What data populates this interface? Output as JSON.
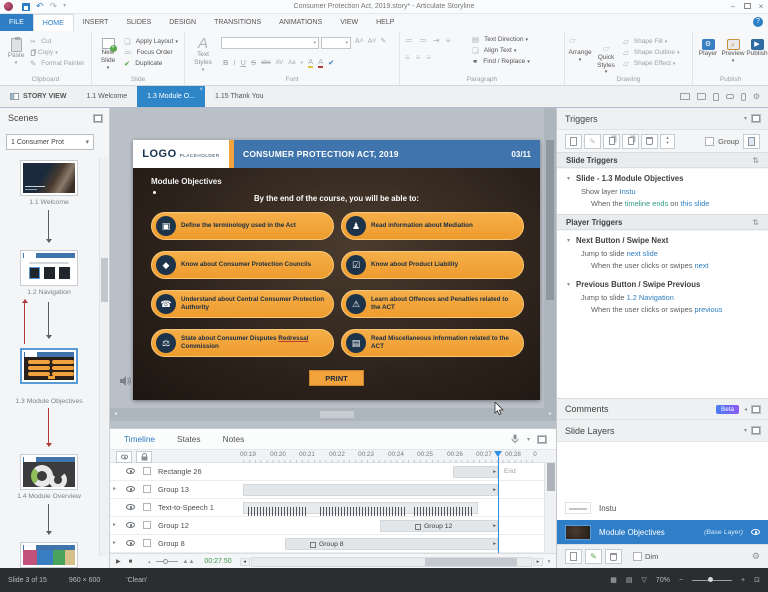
{
  "window": {
    "title": "Consumer Protection Act, 2019.story* - Articulate Storyline"
  },
  "icons": {
    "undo": "↶",
    "redo": "↷",
    "caret": "▾",
    "close": "×",
    "minimize": "–",
    "cut": "✂",
    "gear": "⚙",
    "help": "?",
    "sort": "⇅",
    "left": "◂",
    "right": "▸",
    "up": "▴",
    "down": "▾",
    "play": "▶",
    "stop": "■",
    "grid": "▦",
    "book": "▤",
    "funnel": "▽",
    "minus": "−",
    "plus": "+",
    "fit": "⊡",
    "pencil": "✎",
    "bullets": "≔",
    "numbering": "≕",
    "indent": "⇥",
    "align": "≡",
    "shapes": "▱",
    "arrange_ic": "❏",
    "check": "✔"
  },
  "ribbon_tabs": [
    "FILE",
    "HOME",
    "INSERT",
    "SLIDES",
    "DESIGN",
    "TRANSITIONS",
    "ANIMATIONS",
    "VIEW",
    "HELP"
  ],
  "ribbon": {
    "clipboard": {
      "paste": "Paste",
      "cut": "Cut",
      "copy": "Copy",
      "format_painter": "Format Painter",
      "label": "Clipboard"
    },
    "slide": {
      "new_slide": "New Slide",
      "apply_layout": "Apply Layout",
      "focus_order": "Focus Order",
      "duplicate": "Duplicate",
      "label": "Slide"
    },
    "font": {
      "text_styles": "Text Styles",
      "bold": "B",
      "italic": "I",
      "underline": "U",
      "strike": "S",
      "abc": "abc",
      "av": "AV",
      "aa": "Aa",
      "color": "A",
      "label": "Font"
    },
    "paragraph": {
      "text_direction": "Text Direction",
      "align_text": "Align Text",
      "find_replace": "Find / Replace",
      "label": "Paragraph"
    },
    "drawing": {
      "arrange": "Arrange",
      "quick_styles": "Quick Styles",
      "shape_fill": "Shape Fill",
      "shape_outline": "Shape Outline",
      "shape_effect": "Shape Effect",
      "label": "Drawing"
    },
    "publish": {
      "player": "Player",
      "preview": "Preview",
      "publish": "Publish",
      "label": "Publish"
    }
  },
  "view_tabs": {
    "story_view": "STORY VIEW",
    "items": [
      "1.1 Welcome",
      "1.3 Module O...",
      "1.15 Thank You"
    ]
  },
  "scenes": {
    "title": "Scenes",
    "dropdown": "1 Consumer Prot",
    "items": [
      {
        "label": "1.1 Welcome"
      },
      {
        "label": "1.2 Navigation"
      },
      {
        "label": "1.3 Module Objectives"
      },
      {
        "label": "1.4 Module Overview"
      }
    ]
  },
  "slide": {
    "logo": "LOGO",
    "logo_sub": "PLACEHOLDER",
    "title": "CONSUMER PROTECTION ACT, 2019",
    "page": "03/11",
    "heading": "Module Objectives",
    "intro": "By the end of the course, you will be able to:",
    "objectives": [
      "Define the terminology used in the Act",
      "Read information about Mediation",
      "Know about Consumer Protection Councils",
      "Know about Product Liability",
      "Understand about Central Consumer Protection Authority",
      "Learn about Offences and Penalties related to the ACT",
      "State about Consumer Disputes ",
      "Read Miscellaneous information related to the ACT"
    ],
    "objective7_redressal": "Redressal",
    "objective7_tail": " Commission",
    "objective_icons": [
      "▣",
      "♟",
      "◆",
      "☑",
      "☎",
      "⚠",
      "⚖",
      "▤"
    ],
    "print": "PRINT"
  },
  "triggers": {
    "title": "Triggers",
    "group_label": "Group",
    "slide_triggers_label": "Slide Triggers",
    "slide_group": "Slide - 1.3 Module Objectives",
    "show_layer_pre": "Show layer ",
    "show_layer_link": "Instu",
    "when1_pre": "When the ",
    "when1_kw": "timeline ends",
    "when1_mid": " on ",
    "when1_link": "this slide",
    "player_triggers_label": "Player Triggers",
    "next_group": "Next Button / Swipe Next",
    "next_action_pre": "Jump to slide ",
    "next_action_link": "next slide",
    "next_when_pre": "When the user clicks or swipes ",
    "next_when_link": "next",
    "prev_group": "Previous Button / Swipe Previous",
    "prev_action_pre": "Jump to slide ",
    "prev_action_link": "1.2 Navigation",
    "prev_when_pre": "When the user clicks or swipes ",
    "prev_when_link": "previous"
  },
  "comments": {
    "title": "Comments",
    "badge": "Beta"
  },
  "slide_layers": {
    "title": "Slide Layers",
    "items": [
      {
        "name": "Instu",
        "tag": ""
      },
      {
        "name": "Module Objectives",
        "tag": "(Base Layer)"
      }
    ],
    "dim_label": "Dim"
  },
  "timeline": {
    "tabs": [
      "Timeline",
      "States",
      "Notes"
    ],
    "ruler": [
      "00:19",
      "00:20",
      "00:21",
      "00:22",
      "00:23",
      "00:24",
      "00:25",
      "00:26",
      "00:27",
      "00:28",
      "0"
    ],
    "rows": [
      {
        "name": "Rectangle 26"
      },
      {
        "name": "Group 13"
      },
      {
        "name": "Text-to-Speech 1"
      },
      {
        "name": "Group 12",
        "bar_label": "Group 12"
      },
      {
        "name": "Group 8",
        "bar_label": "Group 8"
      }
    ],
    "end_label": "End",
    "time": "00:27.50"
  },
  "status": {
    "slide_info": "Slide 3 of 15",
    "dimensions": "960 × 600",
    "theme": "'Clean'",
    "zoom": "70%"
  },
  "colors": {
    "accent_blue": "#2e7ec6",
    "slide_header_blue": "#3f74ad",
    "orange": "#f2a33c",
    "link_blue": "#2d7dc1",
    "keyword_green": "#2f9c86",
    "selection_blue": "#2e7ec8",
    "beta_gradient_from": "#4a7cf6",
    "beta_gradient_to": "#8a5cf6"
  }
}
